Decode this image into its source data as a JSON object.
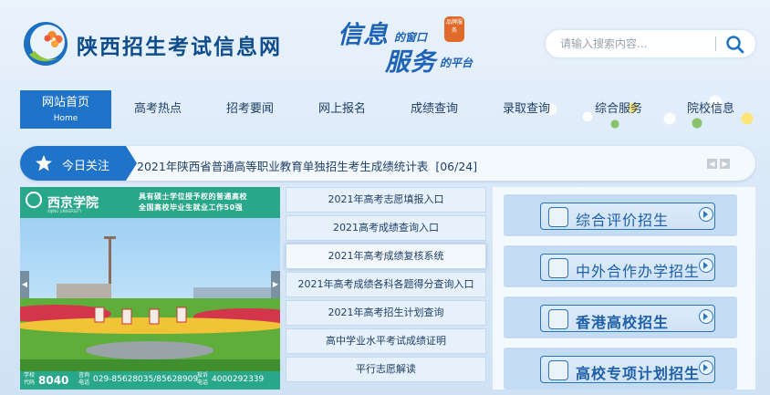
{
  "header": {
    "site_title": "陕西招生考试信息网",
    "slogan": {
      "line1_big": "信息",
      "line1_small": "的窗口",
      "line2_big": "服务",
      "line2_small": "的平台",
      "seal": "品牌服务"
    },
    "search": {
      "placeholder": "请输入搜索内容...",
      "icon": "search-icon"
    }
  },
  "nav": {
    "items": [
      {
        "label": "网站首页",
        "sub": "Home",
        "active": true
      },
      {
        "label": "高考热点"
      },
      {
        "label": "招考要闻"
      },
      {
        "label": "网上报名"
      },
      {
        "label": "成绩查询"
      },
      {
        "label": "录取查询"
      },
      {
        "label": "综合服务"
      },
      {
        "label": "院校信息"
      }
    ]
  },
  "today": {
    "label": "今日关注",
    "headline": "2021年陕西省普通高等职业教育单独招生考生成绩统计表",
    "date": "[06/24]"
  },
  "slide": {
    "school": "西京学院",
    "school_en": "XIJING UNIVERSITY",
    "tag_line1": "具有硕士学位授予权的普通高校",
    "tag_line2": "全国高校毕业生就业工作50强",
    "footer_code_label": "学校代码",
    "footer_code": "8040",
    "footer_phone_label": "咨询电话",
    "footer_phone": "029-85628035/85628909",
    "footer_hotline_label": "投诉电话",
    "footer_hotline": "4000292339"
  },
  "quick_links": [
    "2021年高考志愿填报入口",
    "2021高考成绩查询入口",
    "2021年高考成绩复核系统",
    "2021年高考成绩各科各题得分查询入口",
    "2021年高考招生计划查询",
    "高中学业水平考试成绩证明",
    "平行志愿解读"
  ],
  "categories": [
    {
      "label": "综合评价招生"
    },
    {
      "label": "中外合作办学招生"
    },
    {
      "label": "香港高校招生"
    },
    {
      "label": "高校专项计划招生"
    }
  ],
  "colors": {
    "primary": "#1f73c8",
    "slide_green": "#29a78a"
  }
}
